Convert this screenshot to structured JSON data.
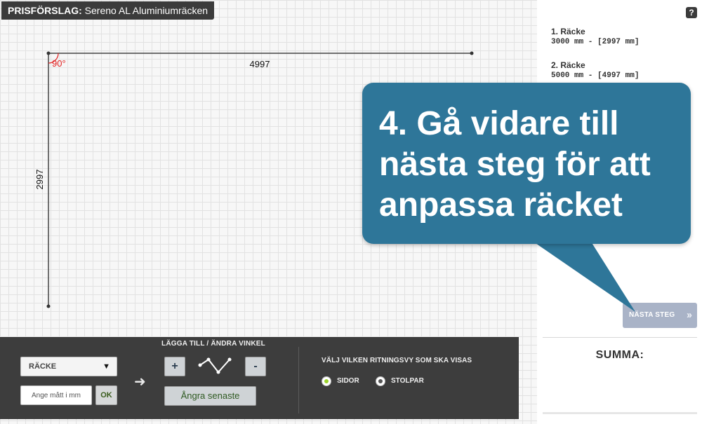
{
  "header": {
    "title_prefix": "PRISFÖRSLAG:",
    "title_rest": "Sereno AL Aluminiumräcken"
  },
  "drawing": {
    "angle_label": "90°",
    "top_length_label": "4997",
    "side_length_label": "2997"
  },
  "sidebar": {
    "help_icon": "?",
    "railings": [
      {
        "name": "1. Räcke",
        "dims": "3000 mm - [2997 mm]"
      },
      {
        "name": "2. Räcke",
        "dims": "5000 mm - [4997 mm]"
      }
    ],
    "next_button_label": "NÄSTA STEG",
    "next_button_chevrons": "››",
    "summa_label": "SUMMA:"
  },
  "callout": {
    "text": "4. Gå vidare till nästa steg för att anpassa räcket",
    "color": "#2e7699"
  },
  "toolbar": {
    "select_value": "RÄCKE",
    "select_arrow": "▼",
    "input_placeholder": "Ange mått i mm",
    "ok_label": "OK",
    "arrow": "➜",
    "angle_section_title": "LÄGGA TILL / ÄNDRA VINKEL",
    "plus_label": "+",
    "minus_label": "-",
    "undo_label": "Ångra senaste",
    "view_title": "VÄLJ VILKEN RITNINGSVY SOM SKA VISAS",
    "view_options": [
      {
        "label": "SIDOR",
        "selected": true
      },
      {
        "label": "STOLPAR",
        "selected": false
      }
    ]
  },
  "colors": {
    "accent_green": "#9bd32d",
    "toolbar_bg": "#3d3d3d",
    "angle_mark": "#e02020"
  }
}
